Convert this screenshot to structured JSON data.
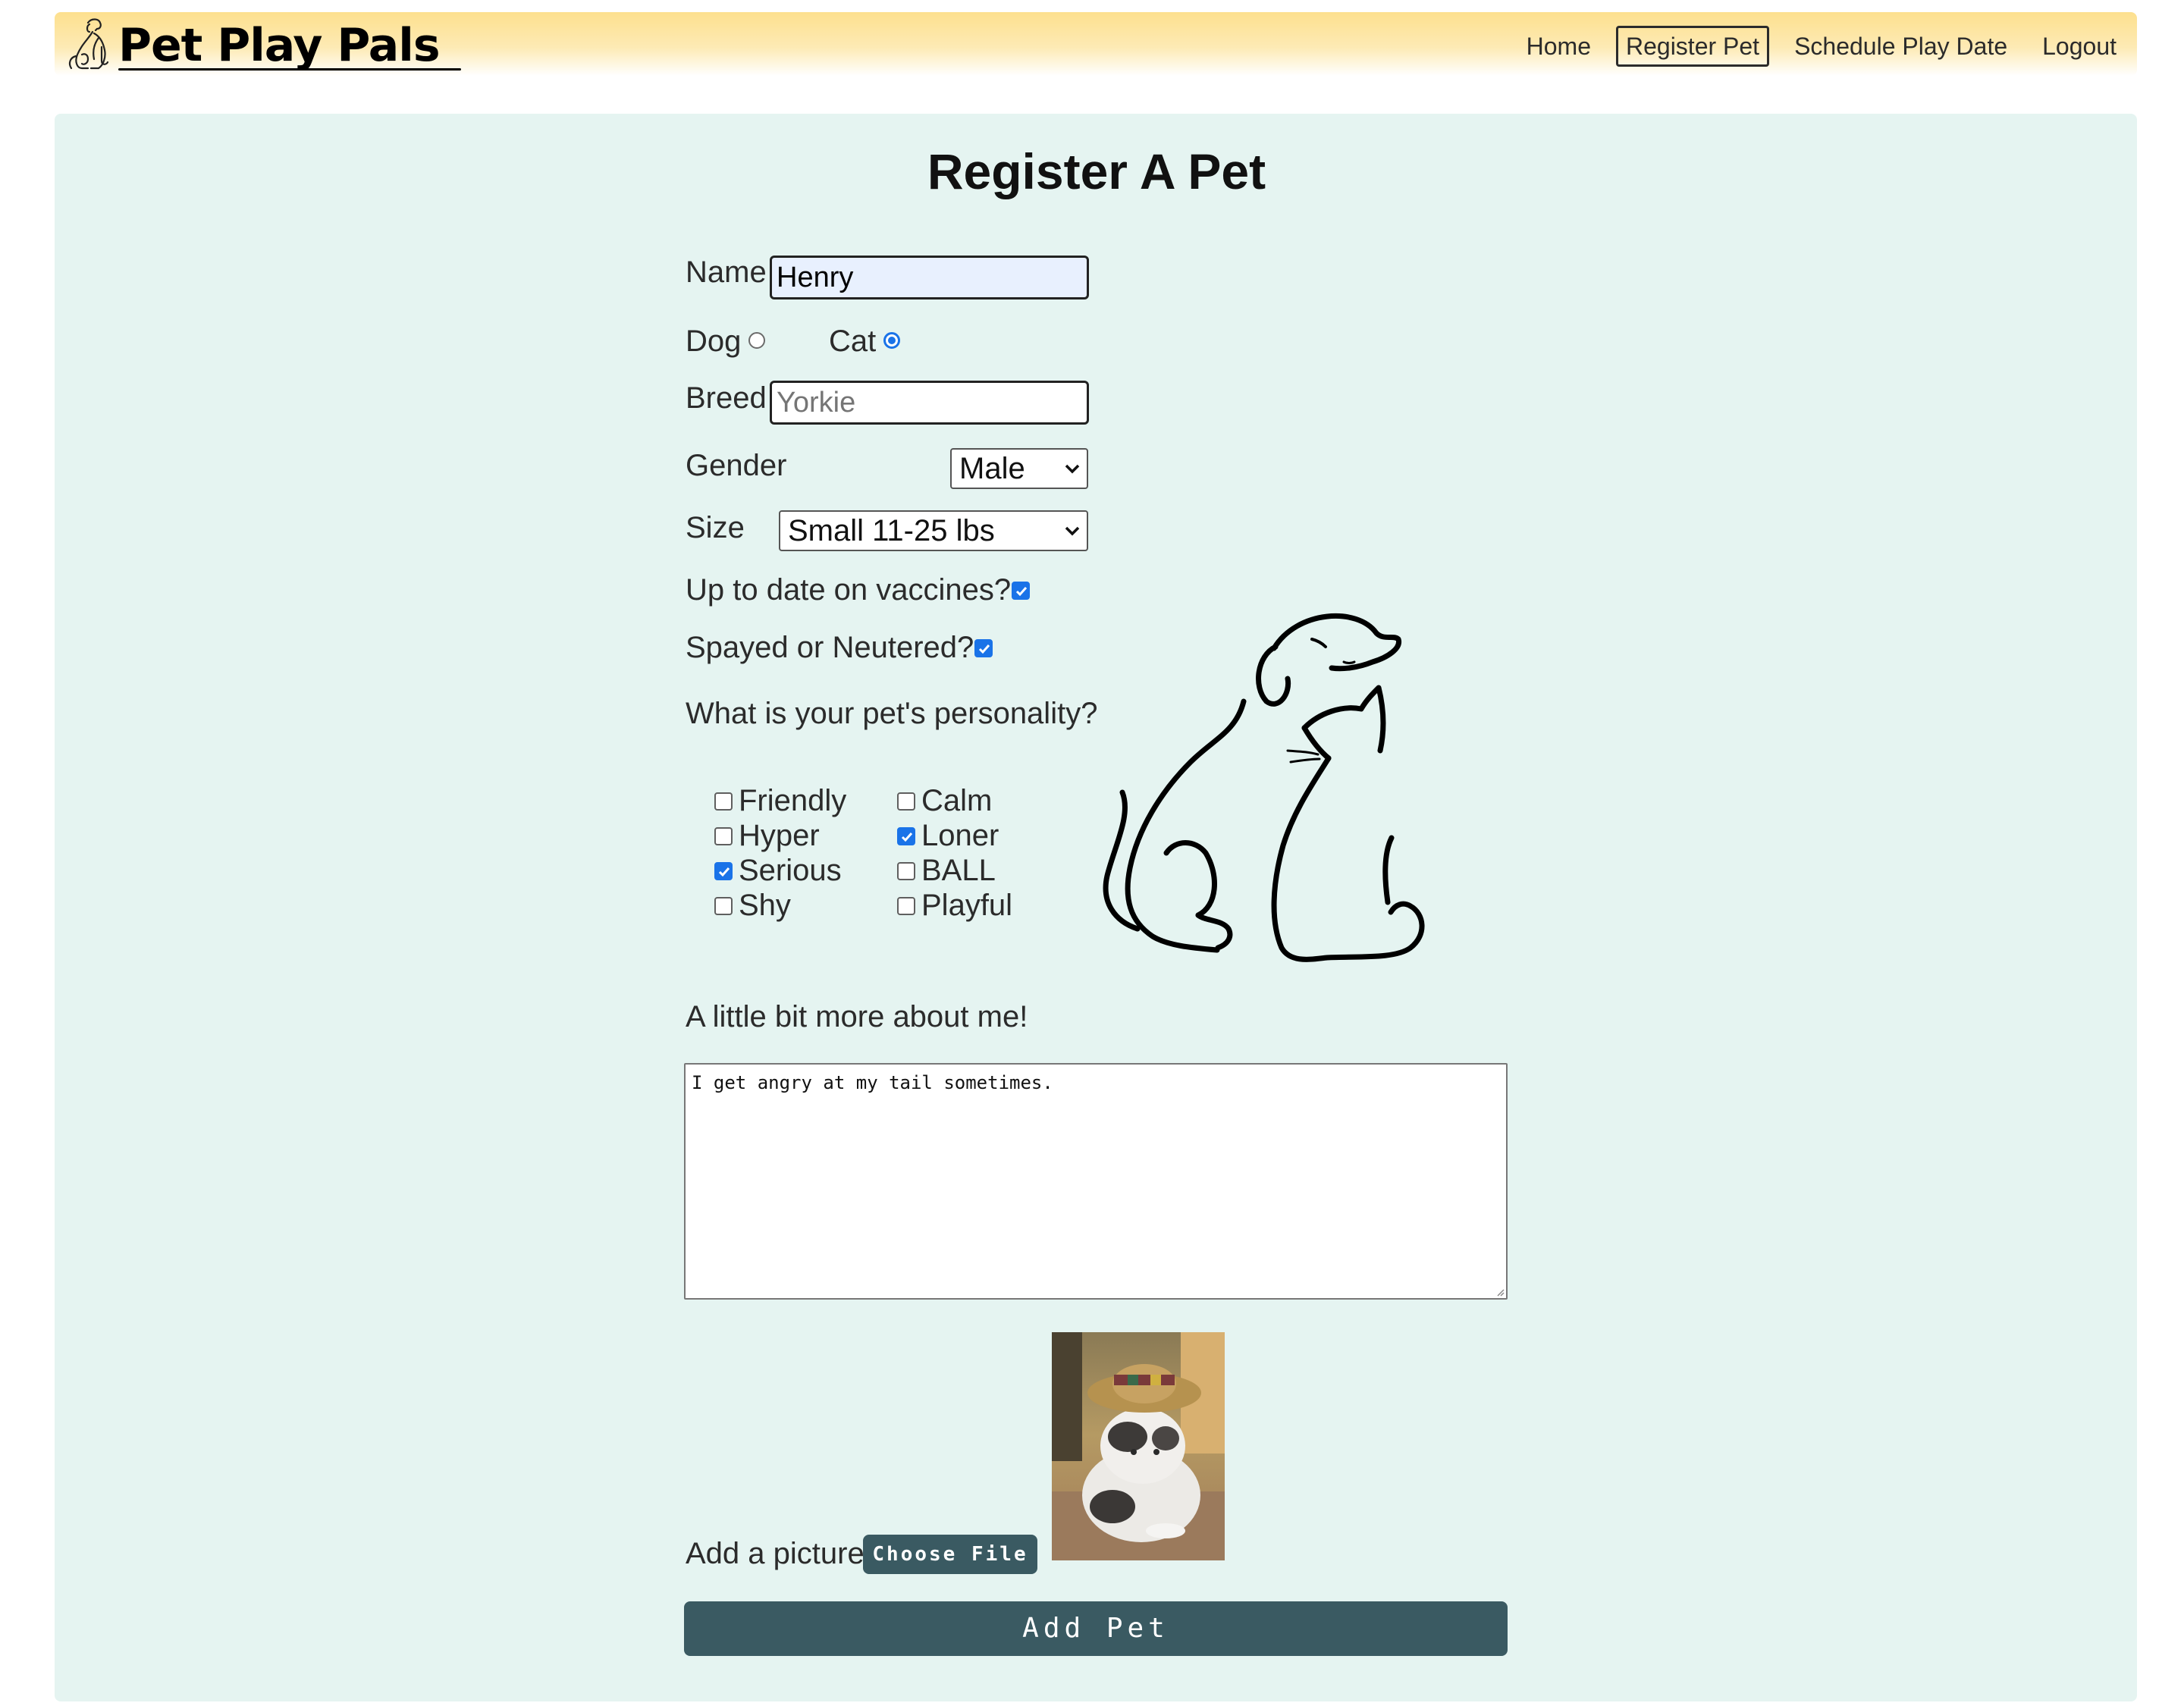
{
  "header": {
    "brand": "Pet Play Pals",
    "nav": [
      {
        "label": "Home",
        "active": false
      },
      {
        "label": "Register Pet",
        "active": true
      },
      {
        "label": "Schedule Play Date",
        "active": false
      },
      {
        "label": "Logout",
        "active": false
      }
    ],
    "background_color": "#fde08e"
  },
  "form": {
    "title": "Register A Pet",
    "name": {
      "label": "Name",
      "value": "Henry"
    },
    "species": [
      {
        "label": "Dog",
        "checked": false
      },
      {
        "label": "Cat",
        "checked": true
      }
    ],
    "breed": {
      "label": "Breed",
      "placeholder": "Yorkie",
      "value": ""
    },
    "gender": {
      "label": "Gender",
      "selected": "Male"
    },
    "size": {
      "label": "Size",
      "selected": "Small 11-25 lbs"
    },
    "vaccines": {
      "label": "Up to date on vaccines?",
      "checked": true
    },
    "spayed": {
      "label": "Spayed or Neutered?",
      "checked": true
    },
    "personality": {
      "question": "What is your pet's personality?",
      "traits": [
        {
          "label": "Friendly",
          "checked": false
        },
        {
          "label": "Calm",
          "checked": false
        },
        {
          "label": "Hyper",
          "checked": false
        },
        {
          "label": "Loner",
          "checked": true
        },
        {
          "label": "Serious",
          "checked": true
        },
        {
          "label": "BALL",
          "checked": false
        },
        {
          "label": "Shy",
          "checked": false
        },
        {
          "label": "Playful",
          "checked": false
        }
      ]
    },
    "about": {
      "label": "A little bit more about me!",
      "value": "I get angry at my tail sometimes."
    },
    "picture": {
      "label": "Add a picture",
      "button": "Choose File"
    },
    "submit": "Add Pet"
  },
  "colors": {
    "panel_background": "#e5f4f1",
    "button": "#3a5a62",
    "accent": "#1a73e8"
  },
  "icons": [
    "dog-cat-logo-icon",
    "dog-cat-illustration",
    "chevron-down-icon",
    "checkmark-icon"
  ]
}
